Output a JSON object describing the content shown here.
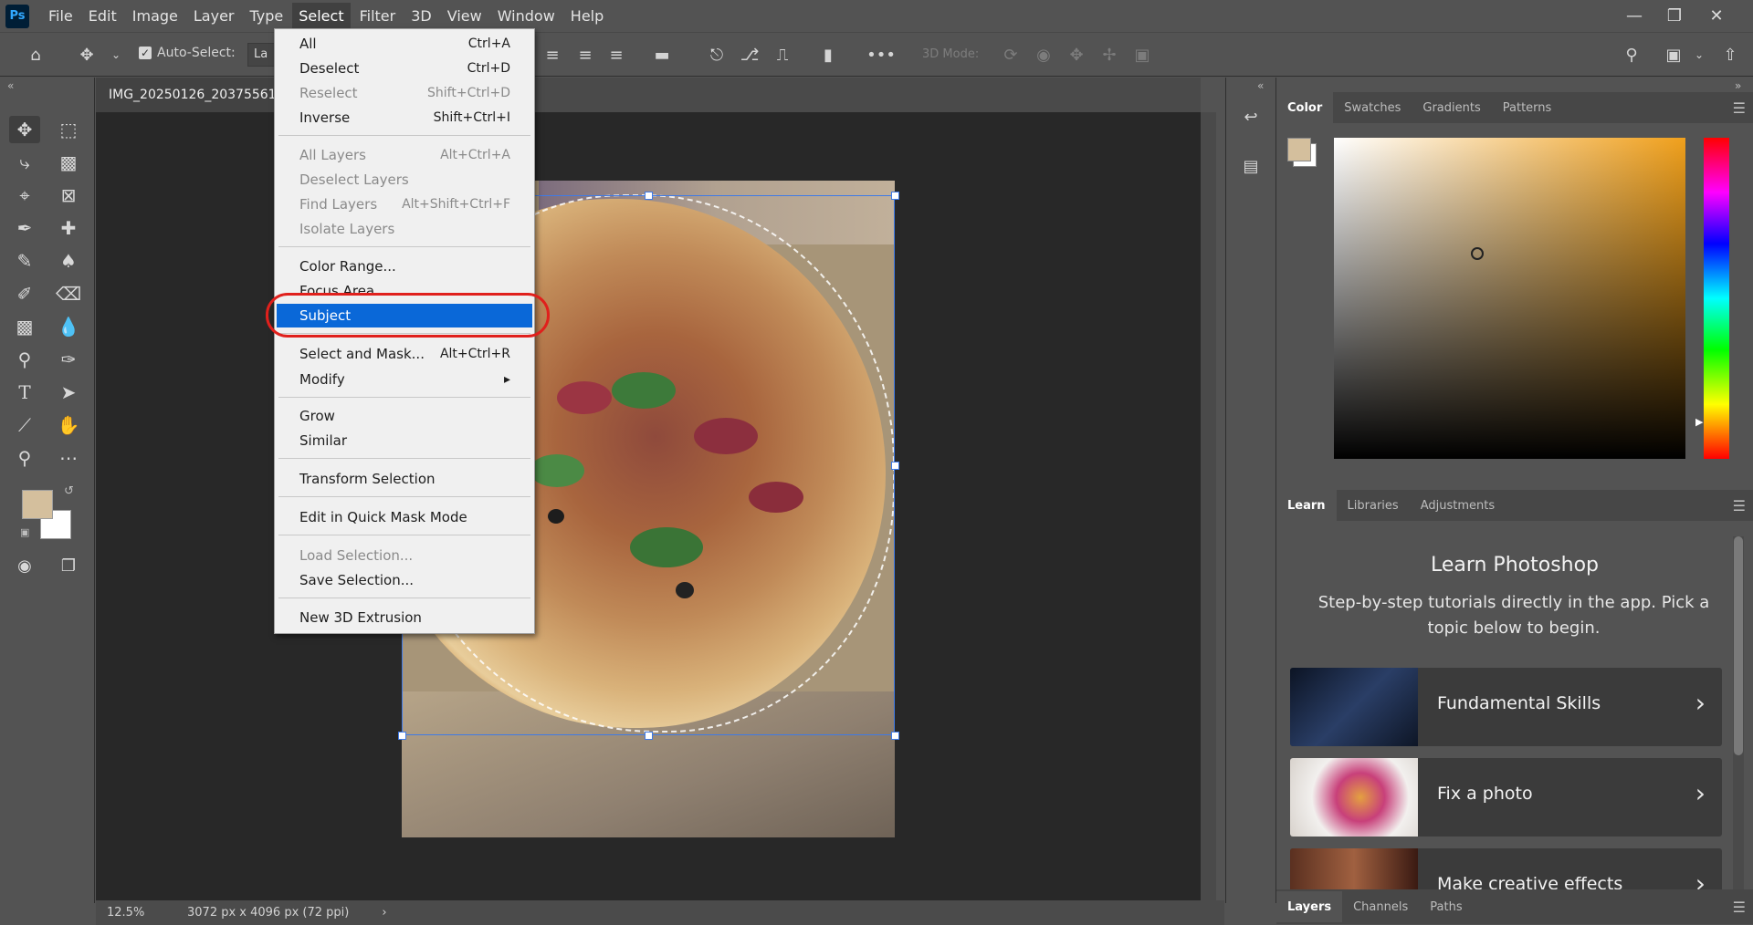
{
  "app": {
    "logo": "Ps"
  },
  "menubar": {
    "items": [
      "File",
      "Edit",
      "Image",
      "Layer",
      "Type",
      "Select",
      "Filter",
      "3D",
      "View",
      "Window",
      "Help"
    ],
    "active": "Select"
  },
  "window_controls": {
    "minimize": "minimize-icon",
    "restore": "restore-icon",
    "close": "close-icon"
  },
  "options_bar": {
    "auto_select_label": "Auto-Select:",
    "layer_dropdown_value": "La",
    "three_d_label": "3D Mode:",
    "more_label": "•••"
  },
  "document": {
    "tab_title": "IMG_20250126_20375561",
    "zoom": "12.5%",
    "dimensions": "3072 px x 4096 px (72 ppi)"
  },
  "select_menu": {
    "items": [
      {
        "label": "All",
        "shortcut": "Ctrl+A",
        "enabled": true
      },
      {
        "label": "Deselect",
        "shortcut": "Ctrl+D",
        "enabled": true
      },
      {
        "label": "Reselect",
        "shortcut": "Shift+Ctrl+D",
        "enabled": false
      },
      {
        "label": "Inverse",
        "shortcut": "Shift+Ctrl+I",
        "enabled": true
      },
      {
        "label": "All Layers",
        "shortcut": "Alt+Ctrl+A",
        "enabled": false
      },
      {
        "label": "Deselect Layers",
        "shortcut": "",
        "enabled": false
      },
      {
        "label": "Find Layers",
        "shortcut": "Alt+Shift+Ctrl+F",
        "enabled": false
      },
      {
        "label": "Isolate Layers",
        "shortcut": "",
        "enabled": false
      },
      {
        "label": "Color Range...",
        "shortcut": "",
        "enabled": true
      },
      {
        "label": "Focus Area...",
        "shortcut": "",
        "enabled": true
      },
      {
        "label": "Subject",
        "shortcut": "",
        "enabled": true,
        "highlighted": true
      },
      {
        "label": "Select and Mask...",
        "shortcut": "Alt+Ctrl+R",
        "enabled": true
      },
      {
        "label": "Modify",
        "shortcut": "▸",
        "enabled": true
      },
      {
        "label": "Grow",
        "shortcut": "",
        "enabled": true
      },
      {
        "label": "Similar",
        "shortcut": "",
        "enabled": true
      },
      {
        "label": "Transform Selection",
        "shortcut": "",
        "enabled": true
      },
      {
        "label": "Edit in Quick Mask Mode",
        "shortcut": "",
        "enabled": true
      },
      {
        "label": "Load Selection...",
        "shortcut": "",
        "enabled": false
      },
      {
        "label": "Save Selection...",
        "shortcut": "",
        "enabled": true
      },
      {
        "label": "New 3D Extrusion",
        "shortcut": "",
        "enabled": true
      }
    ]
  },
  "color_panel": {
    "tabs": [
      "Color",
      "Swatches",
      "Gradients",
      "Patterns"
    ],
    "foreground": "#d4bf9d",
    "background": "#ffffff",
    "hue_color": "#f0a01c"
  },
  "learn_panel": {
    "tabs": [
      "Learn",
      "Libraries",
      "Adjustments"
    ],
    "title": "Learn Photoshop",
    "description": "Step-by-step tutorials directly in the app. Pick a topic below to begin.",
    "cards": [
      {
        "label": "Fundamental Skills"
      },
      {
        "label": "Fix a photo"
      },
      {
        "label": "Make creative effects"
      }
    ]
  },
  "layers_panel": {
    "tabs": [
      "Layers",
      "Channels",
      "Paths"
    ]
  },
  "colors": {
    "accent": "#0a68d8",
    "annotation": "#e0201c"
  }
}
